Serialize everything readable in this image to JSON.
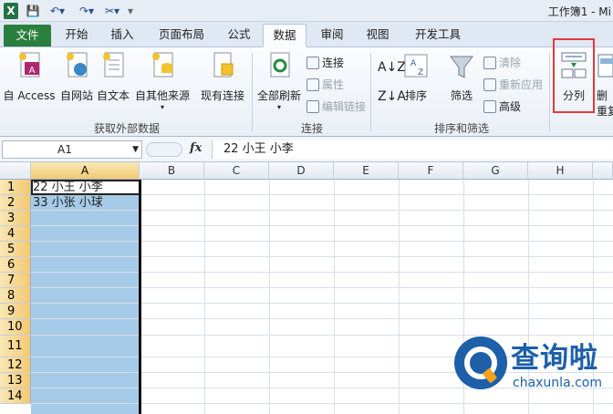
{
  "titlebar": {
    "logo": "X",
    "title": "工作簿1 - Mi"
  },
  "tabs": [
    "文件",
    "开始",
    "插入",
    "页面布局",
    "公式",
    "数据",
    "审阅",
    "视图",
    "开发工具"
  ],
  "active_tab": "数据",
  "ribbon": {
    "get_external": {
      "access": "自 Access",
      "web": "自网站",
      "text": "自文本",
      "other": "自其他来源",
      "existing": "现有连接",
      "label": "获取外部数据"
    },
    "connections": {
      "refresh_all": "全部刷新",
      "connect": "连接",
      "properties": "属性",
      "edit_links": "编辑链接",
      "label": "连接"
    },
    "sort_filter": {
      "sort": "排序",
      "filter": "筛选",
      "clear": "清除",
      "reapply": "重新应用",
      "advanced": "高级",
      "label": "排序和筛选"
    },
    "data_tools": {
      "text_to_columns": "分列",
      "remove": "删",
      "dup": "重复"
    },
    "highlight_color": "#e03a3a"
  },
  "formula_bar": {
    "name_box": "A1",
    "fx": "fx",
    "content": "22 小王 小李"
  },
  "grid": {
    "columns": [
      "A",
      "B",
      "C",
      "D",
      "E",
      "F",
      "G",
      "H"
    ],
    "rows": [
      "1",
      "2",
      "3",
      "4",
      "5",
      "6",
      "7",
      "8",
      "9",
      "10",
      "11",
      "12",
      "13",
      "14"
    ],
    "cells": {
      "A1": "22 小王 小李",
      "A2": "33 小张 小球"
    },
    "selection_color": "#a6cbe8"
  },
  "watermark": {
    "brand": "查询啦",
    "url": "chaxunla.com"
  }
}
